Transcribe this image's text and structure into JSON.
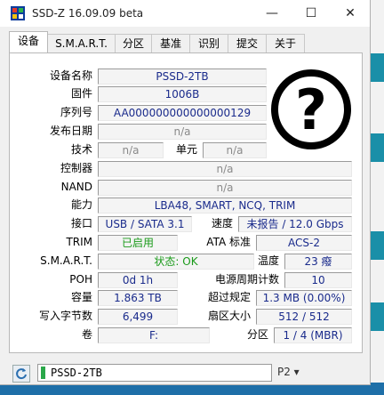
{
  "window": {
    "title": "SSD-Z 16.09.09 beta",
    "min_glyph": "—",
    "max_glyph": "☐",
    "close_glyph": "✕"
  },
  "tabs": [
    "设备",
    "S.M.A.R.T.",
    "分区",
    "基准",
    "识别",
    "提交",
    "关于"
  ],
  "device": {
    "device_name_label": "设备名称",
    "device_name": "PSSD-2TB",
    "firmware_label": "固件",
    "firmware": "1006B",
    "serial_label": "序列号",
    "serial": "AA000000000000000129",
    "release_date_label": "发布日期",
    "release_date": "n/a",
    "technology_label": "技术",
    "technology": "n/a",
    "cells_label": "单元",
    "cells": "n/a",
    "controller_label": "控制器",
    "controller": "n/a",
    "nand_label": "NAND",
    "nand": "n/a",
    "capabilities_label": "能力",
    "capabilities": "LBA48, SMART, NCQ, TRIM",
    "interface_label": "接口",
    "interface": "USB / SATA 3.1",
    "speed_label": "速度",
    "speed": "未报告 / 12.0 Gbps",
    "trim_label": "TRIM",
    "trim": "已启用",
    "ata_label": "ATA 标准",
    "ata": "ACS-2",
    "smart_label": "S.M.A.R.T.",
    "smart": "状态: OK",
    "temp_label": "温度",
    "temp": "23 癈",
    "poh_label": "POH",
    "poh": "0d 1h",
    "power_cycles_label": "电源周期计数",
    "power_cycles": "10",
    "capacity_label": "容量",
    "capacity": "1.863 TB",
    "overprov_label": "超过规定",
    "overprov": "1.3 MB (0.00%)",
    "bytes_written_label": "写入字节数",
    "bytes_written": "6,499",
    "sector_label": "扇区大小",
    "sector": "512 / 512",
    "volume_label": "卷",
    "volume": "F:",
    "partition_label": "分区",
    "partition": "1 / 4 (MBR)"
  },
  "status_bar": {
    "drive": "PSSD-2TB",
    "right_text": "P2 ▾"
  },
  "colors": {
    "value_text": "#1a2b8c",
    "ok_green": "#1a9a1a",
    "panel_bg": "#ffffff",
    "window_bg": "#f0f0f0"
  },
  "icons": {
    "device_image": "question-mark-icon",
    "app": "ssd-z-app-icon",
    "refresh": "refresh-icon"
  }
}
